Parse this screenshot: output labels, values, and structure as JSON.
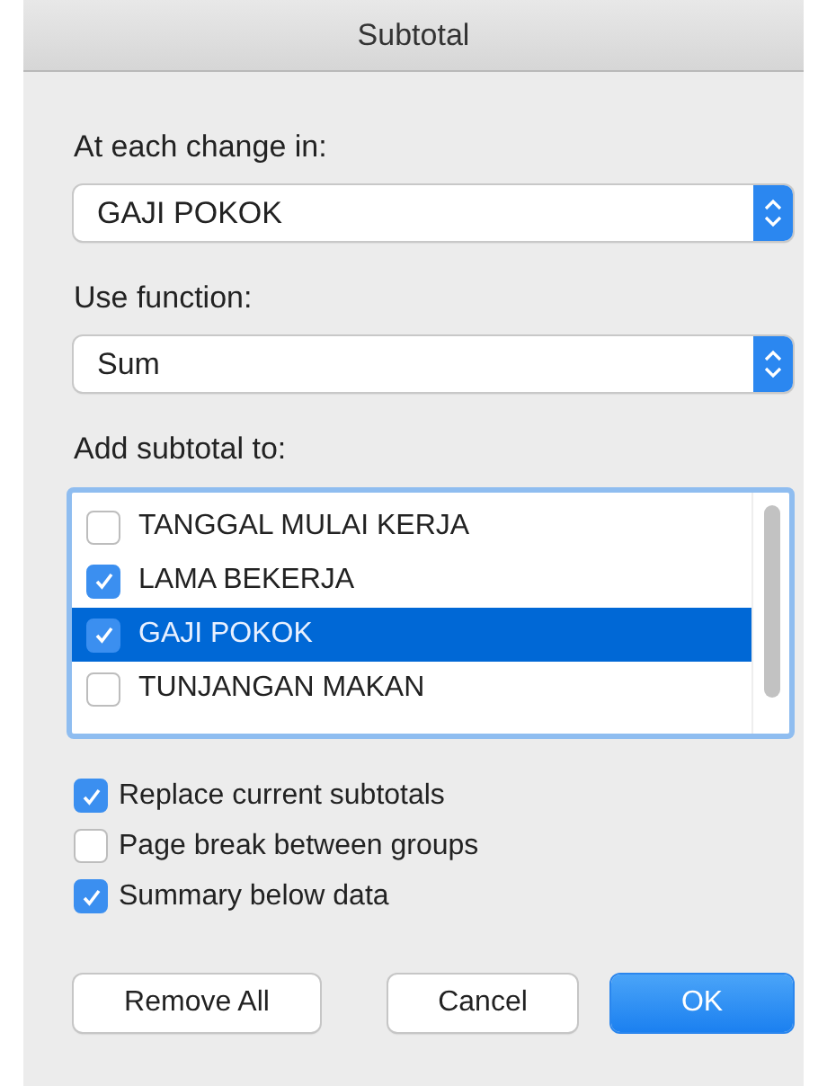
{
  "window": {
    "title": "Subtotal"
  },
  "change_field": {
    "label": "At each change in:",
    "value": "GAJI POKOK"
  },
  "function_field": {
    "label": "Use function:",
    "value": "Sum"
  },
  "subtotal_list": {
    "label": "Add subtotal to:",
    "items": [
      {
        "label": "TANGGAL MULAI KERJA",
        "checked": false,
        "selected": false
      },
      {
        "label": "LAMA BEKERJA",
        "checked": true,
        "selected": false
      },
      {
        "label": "GAJI POKOK",
        "checked": true,
        "selected": true
      },
      {
        "label": "TUNJANGAN MAKAN",
        "checked": false,
        "selected": false
      }
    ]
  },
  "options": [
    {
      "label": "Replace current subtotals",
      "checked": true
    },
    {
      "label": "Page break between groups",
      "checked": false
    },
    {
      "label": "Summary below data",
      "checked": true
    }
  ],
  "buttons": [
    {
      "label": "Remove All",
      "kind": "plain"
    },
    {
      "label": "Cancel",
      "kind": "plain"
    },
    {
      "label": "OK",
      "kind": "default"
    }
  ]
}
